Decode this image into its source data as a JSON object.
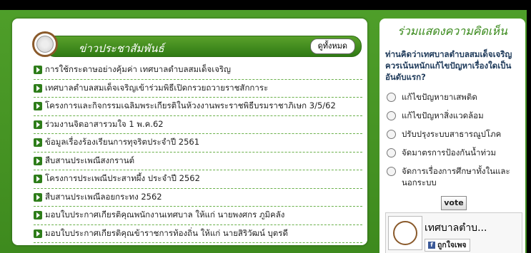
{
  "news": {
    "title": "ข่าวประชาสัมพันธ์",
    "all_label": "ดูทั้งหมด",
    "items": [
      "การใช้กระดาษอย่างคุ้มค่า เทศบาลตำบลสมเด็จเจริญ",
      "เทศบาลตำบลสมเด็จเจริญเข้าร่วมพิธีเปิดกรวยถวายราชสักการะ",
      "โครงการและกิจกรรมเฉลิมพระเกียรติในห้วงงานพระราชพิธีบรมราชาภิเษก 3/5/62",
      "ร่วมงานจิตอาสารวมใจ 1 พ.ค.62",
      "ข้อมูลเรื่องร้องเรียนการทุจริตประจำปี 2561",
      "สืบสานประเพณีสงกรานต์",
      "โครงการประเพณีประสาทผึ้ง ประจำปี 2562",
      "สืบสานประเพณีลอยกระทง 2562",
      "มอบใบประกาศเกียรติคุณพนักงานเทศบาล ให้แก่ นายพงศกร ภูมิคลัง",
      "มอบใบประกาศเกียรติคุณข้าราชการท้องถิ่น ให้แก่ นายสิริวัฒน์ บุตรดี"
    ]
  },
  "poll": {
    "title": "ร่วมแสดงความคิดเห็น",
    "question": "ท่านคิดว่าเทศบาลตำบลสมเด็จเจริญ ควรเน้นหนักแก้ไขปัญหาเรื่องใดเป็น อันดับแรก?",
    "options": [
      "แก้ไขปัญหายาเสพติด",
      "แก้ไขปัญหาสิ่งแวดล้อม",
      "ปรับปรุงระบบสาธารณูปโภค",
      "จัดมาตรการป้องกันน้ำท่วม",
      "จัดการเรื่องการศึกษาทั้งในและนอกระบบ"
    ],
    "vote_label": "vote"
  },
  "facebook": {
    "page_name": "เทศบาลตำบ...",
    "like_label": "ถูกใจเพจ"
  }
}
